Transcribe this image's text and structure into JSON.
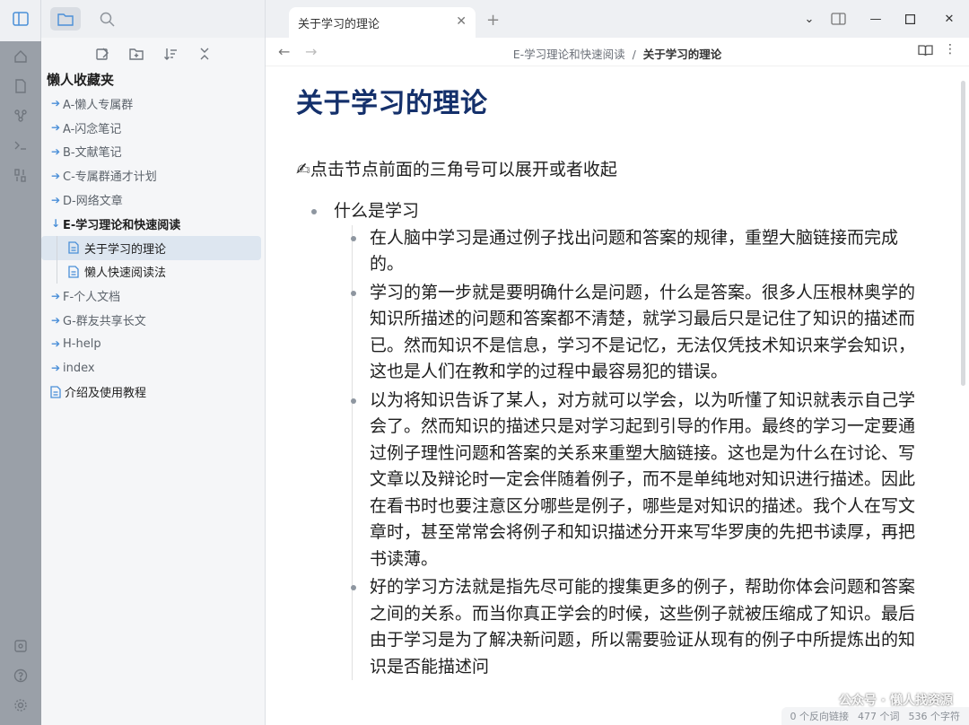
{
  "sidebar": {
    "vault_title": "懒人收藏夹",
    "items": [
      {
        "label": "A-懒人专属群"
      },
      {
        "label": "A-闪念笔记"
      },
      {
        "label": "B-文献笔记"
      },
      {
        "label": "C-专属群通才计划"
      },
      {
        "label": "D-网络文章"
      },
      {
        "label": "E-学习理论和快速阅读"
      },
      {
        "label": "关于学习的理论"
      },
      {
        "label": "懒人快速阅读法"
      },
      {
        "label": "F-个人文档"
      },
      {
        "label": "G-群友共享长文"
      },
      {
        "label": "H-help"
      },
      {
        "label": "index"
      },
      {
        "label": "介绍及使用教程"
      }
    ]
  },
  "tab": {
    "label": "关于学习的理论"
  },
  "breadcrumb": {
    "parent": "E-学习理论和快速阅读",
    "sep": "/",
    "current": "关于学习的理论"
  },
  "note": {
    "title": "关于学习的理论",
    "intro": "✍点击节点前面的三角号可以展开或者收起",
    "l1": "什么是学习",
    "l2": [
      "在人脑中学习是通过例子找出问题和答案的规律，重塑大脑链接而完成的。",
      "学习的第一步就是要明确什么是问题，什么是答案。很多人压根林奥学的知识所描述的问题和答案都不清楚，就学习最后只是记住了知识的描述而已。然而知识不是信息，学习不是记忆，无法仅凭技术知识来学会知识，这也是人们在教和学的过程中最容易犯的错误。",
      "以为将知识告诉了某人，对方就可以学会，以为听懂了知识就表示自己学会了。然而知识的描述只是对学习起到引导的作用。最终的学习一定要通过例子理性问题和答案的关系来重塑大脑链接。这也是为什么在讨论、写文章以及辩论时一定会伴随着例子，而不是单纯地对知识进行描述。因此在看书时也要注意区分哪些是例子，哪些是对知识的描述。我个人在写文章时，甚至常常会将例子和知识描述分开来写华罗庚的先把书读厚，再把书读薄。",
      "好的学习方法就是指先尽可能的搜集更多的例子，帮助你体会问题和答案之间的关系。而当你真正学会的时候，这些例子就被压缩成了知识。最后由于学习是为了解决新问题，所以需要验证从现有的例子中所提炼出的知识是否能描述问"
    ]
  },
  "status": {
    "backlinks": "0 个反向链接",
    "words": "477 个词",
    "chars": "536 个字符"
  },
  "watermark": "公众号 · 懒人找资源"
}
